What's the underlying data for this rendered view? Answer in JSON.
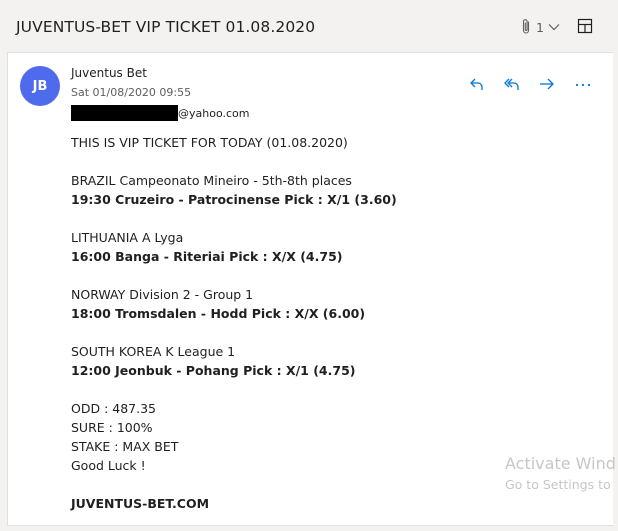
{
  "subject": "JUVENTUS-BET VIP TICKET 01.08.2020",
  "attachments": {
    "count": "1",
    "icon": "paperclip-icon"
  },
  "sender": {
    "initials": "JB",
    "avatar_color": "#4f6bed",
    "name": "Juventus Bet",
    "date": "Sat 01/08/2020 09:55",
    "to_suffix": "@yahoo.com"
  },
  "actions": [
    {
      "name": "reply-icon"
    },
    {
      "name": "reply-all-icon"
    },
    {
      "name": "forward-icon"
    },
    {
      "name": "more-options-icon"
    }
  ],
  "accent_color": "#0078d4",
  "message": {
    "intro": "THIS IS VIP TICKET FOR TODAY (01.08.2020)",
    "matches": [
      {
        "league": "BRAZIL Campeonato Mineiro - 5th-8th places",
        "pick": "19:30  Cruzeiro - Patrocinense  Pick : X/1 (3.60)"
      },
      {
        "league": "LITHUANIA A Lyga",
        "pick": "16:00  Banga - Riteriai  Pick : X/X (4.75)"
      },
      {
        "league": "NORWAY Division 2 - Group 1",
        "pick": "18:00  Tromsdalen - Hodd  Pick : X/X (6.00)"
      },
      {
        "league": "SOUTH KOREA K League 1",
        "pick": "12:00  Jeonbuk - Pohang  Pick : X/1 (4.75)"
      }
    ],
    "odd": "ODD : 487.35",
    "sure": "SURE : 100%",
    "stake": "STAKE : MAX BET",
    "luck": "Good Luck !",
    "signature": "JUVENTUS-BET.COM"
  },
  "watermark": {
    "line1": "Activate Wind",
    "line2": "Go to Settings to"
  }
}
